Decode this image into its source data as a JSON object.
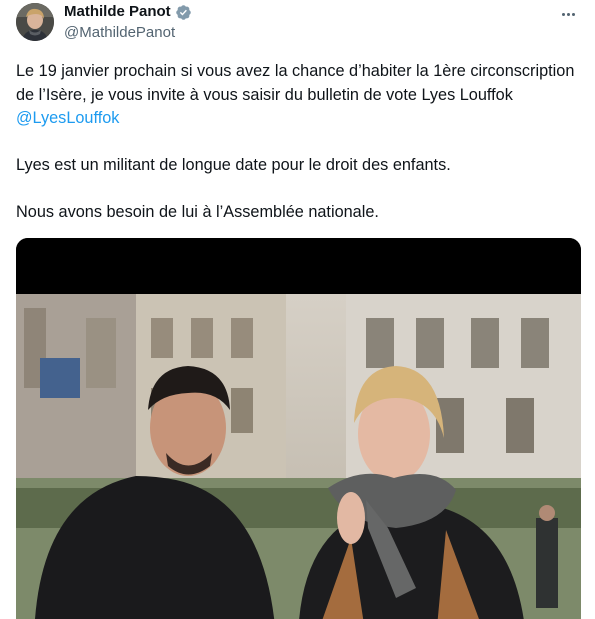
{
  "author": {
    "display_name": "Mathilde Panot",
    "handle": "@MathildePanot",
    "verified_icon": "verified-badge-icon",
    "verified_color": "#829aab"
  },
  "menu": {
    "more_icon": "more-horizontal-icon"
  },
  "tweet": {
    "paragraph_1_text": "Le 19 janvier prochain si vous avez la chance d’habiter la 1ère circonscription de l’Isère, je vous invite à vous saisir du bulletin de vote Lyes Louffok",
    "paragraph_1_mention": "@LyesLouffok",
    "paragraph_2": "Lyes est un militant de longue date pour le droit des enfants.",
    "paragraph_3": "Nous avons besoin de lui à l’Assemblée nationale."
  },
  "media": {
    "type": "video"
  },
  "colors": {
    "text": "#0f1419",
    "secondary": "#536471",
    "link": "#1d9bf0"
  }
}
